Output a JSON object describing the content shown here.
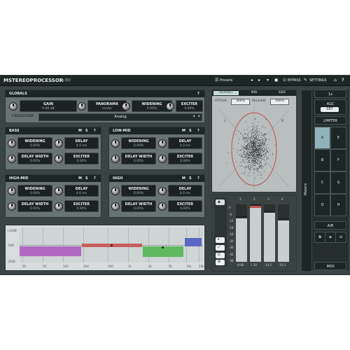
{
  "app": {
    "title": "MSTEREOPROCESSOR",
    "version": "(g.00)"
  },
  "topbar": {
    "presets": "Presets",
    "bypass": "BYPASS",
    "settings": "SETTINGS",
    "help": "?"
  },
  "globals": {
    "title": "GLOBALS",
    "gain": {
      "label": "GAIN",
      "value": "0.00 dB"
    },
    "panorama": {
      "label": "PANORAMA",
      "value": "center"
    },
    "widening": {
      "label": "WIDENING",
      "value": "0.00%"
    },
    "exciter": {
      "label": "EXCITER",
      "value": "0.00%"
    },
    "crossover_label": "CROSSOVER",
    "crossover_value": "Analog"
  },
  "bands": [
    {
      "title": "BASS",
      "m": "M",
      "s": "S",
      "q": "?",
      "widening": {
        "label": "WIDENING",
        "value": "0.00%"
      },
      "delay": {
        "label": "DELAY",
        "value": "4.0 ms"
      },
      "delay_width": {
        "label": "DELAY WIDTH",
        "value": "0.00%"
      },
      "exciter": {
        "label": "EXCITER",
        "value": "0.00%"
      }
    },
    {
      "title": "LOW-MID",
      "m": "M",
      "s": "S",
      "q": "?",
      "widening": {
        "label": "WIDENING",
        "value": "0.00%"
      },
      "delay": {
        "label": "DELAY",
        "value": "4.0 ms"
      },
      "delay_width": {
        "label": "DELAY WIDTH",
        "value": "0.00%"
      },
      "exciter": {
        "label": "EXCITER",
        "value": "0.00%"
      }
    },
    {
      "title": "HIGH-MID",
      "m": "M",
      "s": "S",
      "q": "?",
      "widening": {
        "label": "WIDENING",
        "value": "0.00%"
      },
      "delay": {
        "label": "DELAY",
        "value": "4.0 ms"
      },
      "delay_width": {
        "label": "DELAY WIDTH",
        "value": "0.00%"
      },
      "exciter": {
        "label": "EXCITER",
        "value": "0.00%"
      }
    },
    {
      "title": "HIGH",
      "m": "M",
      "s": "S",
      "q": "?",
      "widening": {
        "label": "WIDENING",
        "value": "0.00%"
      },
      "delay": {
        "label": "DELAY",
        "value": "4.0 ms"
      },
      "delay_width": {
        "label": "DELAY WIDTH",
        "value": "0.00%"
      },
      "exciter": {
        "label": "EXCITER",
        "value": "0.00%"
      }
    }
  ],
  "eq": {
    "y_labels": [
      "+20dB",
      "0dB",
      "-20dB"
    ],
    "x_labels": [
      "20",
      "50",
      "100",
      "200",
      "500",
      "1k",
      "2k",
      "5k",
      "10k",
      "20k"
    ]
  },
  "scope": {
    "tabs": [
      "DEFAULT",
      "MID",
      "SIDE"
    ],
    "attack_label": "ATTACK",
    "attack_value": "300%",
    "release_label": "RELEASE",
    "release_value": "100%",
    "corner_labels": [
      "L",
      "R"
    ]
  },
  "meters": {
    "scale": [
      "0",
      "-6",
      "-12",
      "-18",
      "-24",
      "-30",
      "-36",
      "-42",
      "-48"
    ],
    "top_labels": [
      "1",
      "2",
      "3",
      "4"
    ],
    "bottom_values": [
      "-6.80",
      "1.10",
      "-14.2",
      "-10.3"
    ],
    "levels": [
      0.75,
      0.98,
      0.85,
      0.72
    ]
  },
  "sidebar": {
    "vertical_label": "Meters",
    "top_buttons": [
      "1x",
      "AGC",
      "SET",
      "LIMITER"
    ],
    "presets": [
      "A",
      "B",
      "C",
      "D",
      "E",
      "F",
      "G",
      "H"
    ],
    "ab": "A/B",
    "midi": "MIDI"
  },
  "colors": {
    "accent": "#9ec3ca",
    "active_preset": "#8fb3bb",
    "band_bass": "#b068c2",
    "band_lowmid": "#c85e5e",
    "band_highmid": "#5fb85f",
    "band_high": "#5a67c2"
  }
}
